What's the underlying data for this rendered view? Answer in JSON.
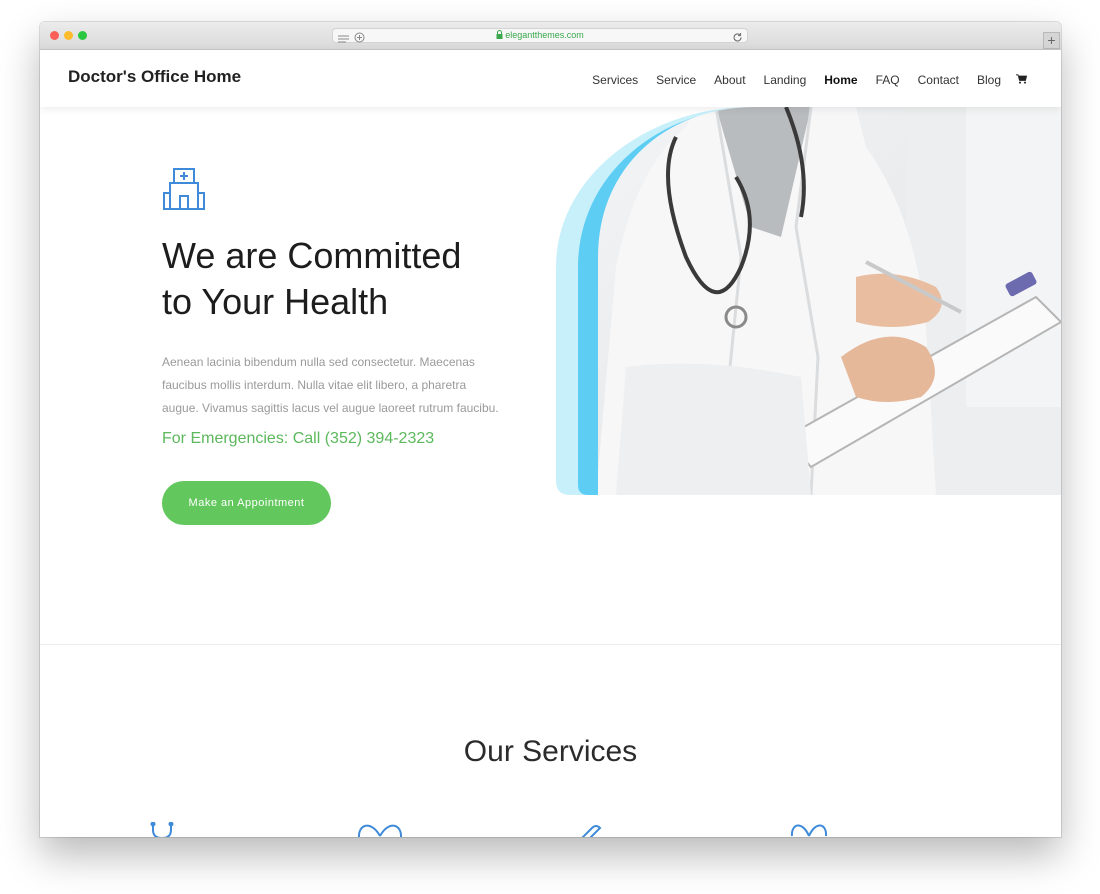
{
  "browser": {
    "url": "elegantthemes.com",
    "newtab_label": "+"
  },
  "header": {
    "site_title": "Doctor's Office Home",
    "nav": [
      "Services",
      "Service",
      "About",
      "Landing",
      "Home",
      "FAQ",
      "Contact",
      "Blog"
    ],
    "active_nav": "Home",
    "cart_icon": "cart-icon"
  },
  "hero": {
    "icon": "hospital-icon",
    "title_line1": "We are Committed",
    "title_line2": "to Your Health",
    "text_line1": "Aenean lacinia bibendum nulla sed consectetur. Maecenas",
    "text_line2": "faucibus mollis interdum. Nulla vitae elit libero, a pharetra",
    "text_line3": "augue. Vivamus sagittis lacus vel augue laoreet rutrum faucibu.",
    "emergency": "For Emergencies: Call (352) 394-2323",
    "cta": "Make an Appointment"
  },
  "services": {
    "title": "Our Services",
    "icons": [
      "stethoscope-icon",
      "heart-icon",
      "syringe-icon",
      "heart-icon"
    ]
  },
  "colors": {
    "accent_green": "#62c75c",
    "accent_blue": "#3f8ad9",
    "arch_light": "#c8f0fb",
    "arch_mid": "#5ecdf4"
  }
}
